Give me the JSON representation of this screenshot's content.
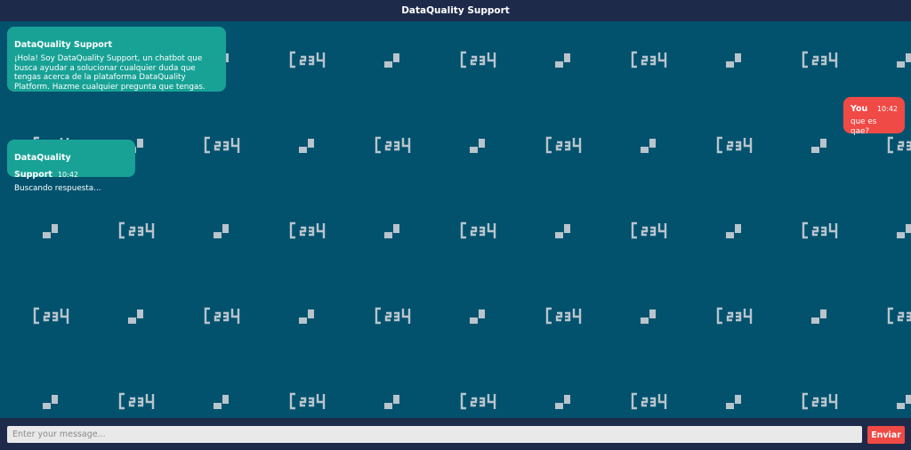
{
  "header": {
    "title": "DataQuality Support"
  },
  "messages": [
    {
      "role": "bot",
      "sender": "DataQuality Support",
      "time": "",
      "text": "¡Hola! Soy DataQuality Support, un chatbot que busca ayudar a solucionar cualquier duda que tengas acerca de la plataforma DataQuality Platform. Hazme cualquier pregunta que tengas."
    },
    {
      "role": "user",
      "sender": "You",
      "time": "10:42",
      "text": "que es qae?"
    },
    {
      "role": "bot",
      "sender": "DataQuality Support",
      "time": "10:42",
      "text": "Buscando respuesta..."
    }
  ],
  "composer": {
    "placeholder": "Enter your message...",
    "send_label": "Enviar"
  },
  "colors": {
    "chat_bg": "#02526e",
    "frame_bg": "#1e2a4a",
    "bot_bubble": "#18a296",
    "user_bubble": "#ef4a45",
    "pattern": "#b9c4cc"
  },
  "background_pattern": {
    "icons": [
      "logo-watermark-icon",
      "corner-mark-icon"
    ]
  }
}
